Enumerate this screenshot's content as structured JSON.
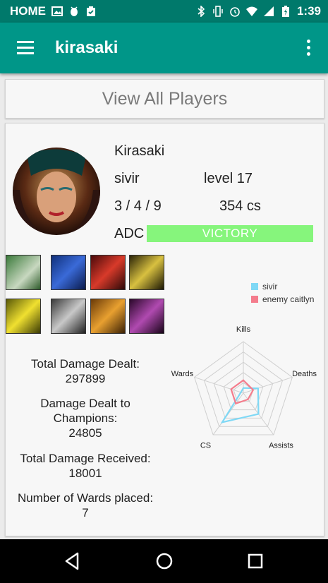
{
  "status_bar": {
    "label": "HOME",
    "time": "1:39",
    "left_icons": [
      "image-icon",
      "android-debug-icon",
      "clipboard-check-icon"
    ],
    "right_icons": [
      "bluetooth-icon",
      "vibrate-icon",
      "alarm-icon",
      "wifi-icon",
      "signal-icon",
      "battery-charging-icon"
    ]
  },
  "app_bar": {
    "title": "kirasaki",
    "menu_icon": "hamburger-menu-icon",
    "overflow_icon": "more-vert-icon"
  },
  "view_all_button": "View All Players",
  "player": {
    "summoner": "Kirasaki",
    "champion": "sivir",
    "level": "level 17",
    "kda": "3 / 4 / 9",
    "cs": "354 cs",
    "role": "ADC",
    "result": "VICTORY",
    "result_color": "#86f57c"
  },
  "items": [
    {
      "name": "champion-spell-icon"
    },
    {
      "name": "item-bow-icon"
    },
    {
      "name": "item-red-claw-icon"
    },
    {
      "name": "item-golden-blade-icon"
    },
    {
      "name": "summoner-flash-icon"
    },
    {
      "name": "item-shield-helm-icon"
    },
    {
      "name": "item-dagger-icon"
    },
    {
      "name": "item-dark-sword-icon"
    }
  ],
  "stats": [
    {
      "label": "Total Damage Dealt:",
      "value": "297899"
    },
    {
      "label": "Damage Dealt to Champions:",
      "value": "24805"
    },
    {
      "label": "Total Damage Received:",
      "value": "18001"
    },
    {
      "label": "Number of Wards placed:",
      "value": "7"
    }
  ],
  "chart_data": {
    "type": "radar",
    "axes": [
      "Kills",
      "Deaths",
      "Assists",
      "CS",
      "Wards"
    ],
    "series": [
      {
        "name": "sivir",
        "color": "#7fd8f5",
        "values": [
          0.1,
          0.3,
          0.5,
          0.7,
          0.05
        ]
      },
      {
        "name": "enemy caitlyn",
        "color": "#f47c8c",
        "values": [
          0.25,
          0.2,
          0.15,
          0.25,
          0.25
        ]
      }
    ],
    "grid_levels": 5,
    "legend_position": "top-right"
  },
  "nav": {
    "back": "back-icon",
    "home": "home-icon",
    "recents": "recents-icon"
  }
}
